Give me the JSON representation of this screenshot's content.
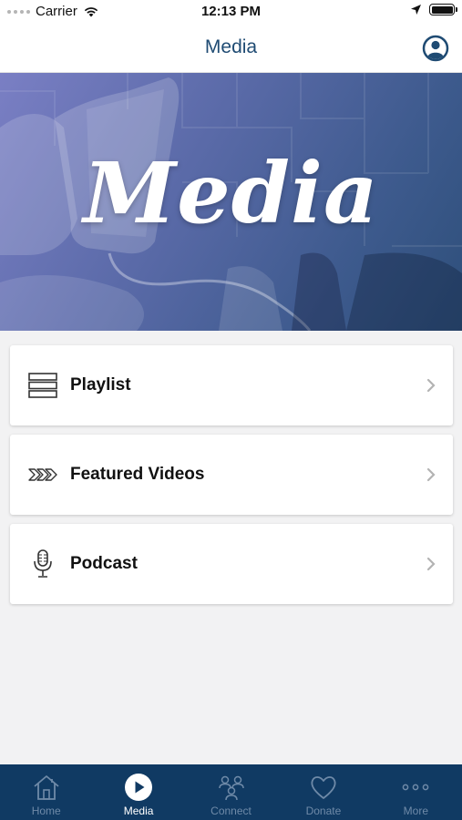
{
  "status_bar": {
    "carrier": "Carrier",
    "time": "12:13 PM"
  },
  "nav": {
    "title": "Media",
    "profile_icon": "person-circle-icon"
  },
  "hero": {
    "title": "Media"
  },
  "menu": {
    "items": [
      {
        "label": "Playlist",
        "icon": "list-icon"
      },
      {
        "label": "Featured Videos",
        "icon": "chevrons-right-icon"
      },
      {
        "label": "Podcast",
        "icon": "microphone-icon"
      }
    ]
  },
  "tab_bar": {
    "tabs": [
      {
        "label": "Home",
        "icon": "house-icon",
        "active": false
      },
      {
        "label": "Media",
        "icon": "play-circle-icon",
        "active": true
      },
      {
        "label": "Connect",
        "icon": "people-icon",
        "active": false
      },
      {
        "label": "Donate",
        "icon": "heart-icon",
        "active": false
      },
      {
        "label": "More",
        "icon": "ellipsis-icon",
        "active": false
      }
    ]
  },
  "colors": {
    "nav_title": "#1f4b73",
    "tab_bar_bg": "#103a63",
    "tab_inactive": "#6f8aa8",
    "tab_active": "#ffffff",
    "page_bg": "#f2f2f3"
  }
}
